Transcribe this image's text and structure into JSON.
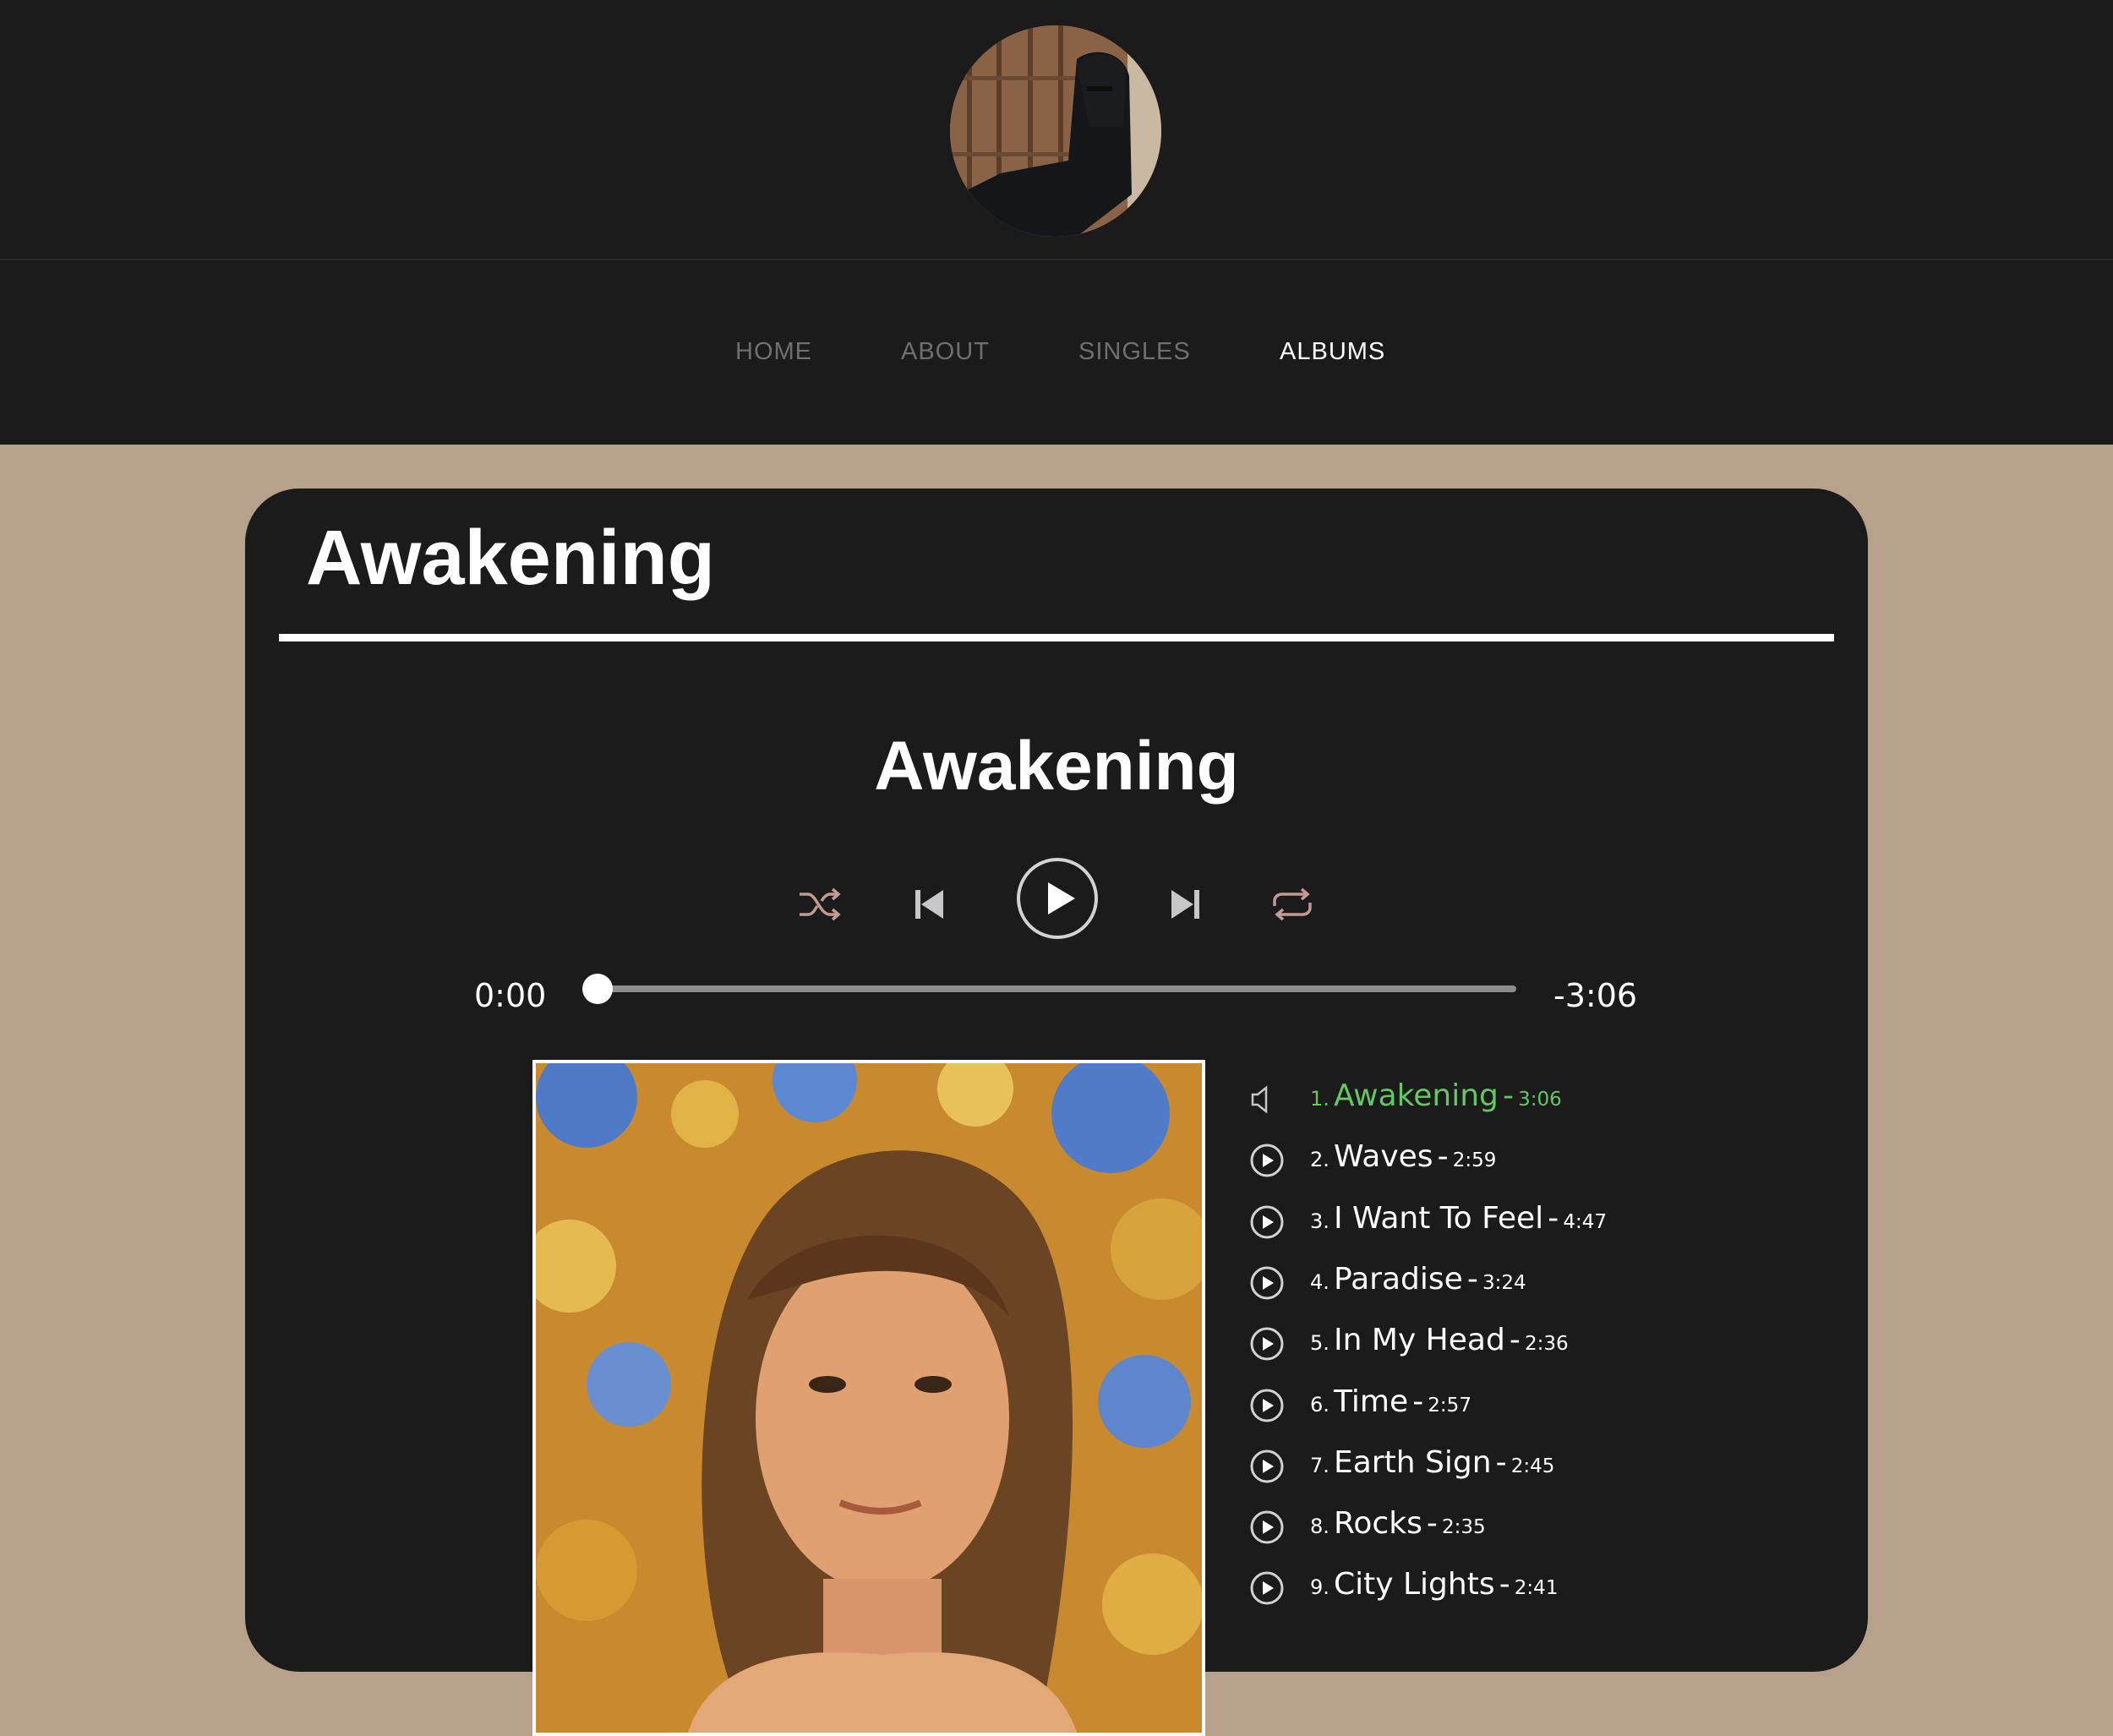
{
  "header": {
    "avatar_alt": "artist-avatar"
  },
  "nav": {
    "items": [
      {
        "label": "HOME",
        "active": false
      },
      {
        "label": "ABOUT",
        "active": false
      },
      {
        "label": "SINGLES",
        "active": false
      },
      {
        "label": "ALBUMS",
        "active": true
      }
    ]
  },
  "album": {
    "heading": "Awakening",
    "player_title": "Awakening",
    "elapsed": "0:00",
    "remaining": "-3:06",
    "progress": 0,
    "controls": [
      "shuffle-icon",
      "previous-icon",
      "play-icon",
      "next-icon",
      "repeat-icon"
    ],
    "tracks": [
      {
        "num": "1.",
        "title": "Awakening",
        "sep": "-",
        "duration": "3:06",
        "current": true
      },
      {
        "num": "2.",
        "title": "Waves",
        "sep": "-",
        "duration": "2:59",
        "current": false
      },
      {
        "num": "3.",
        "title": "I Want To Feel",
        "sep": "-",
        "duration": "4:47",
        "current": false
      },
      {
        "num": "4.",
        "title": "Paradise",
        "sep": "-",
        "duration": "3:24",
        "current": false
      },
      {
        "num": "5.",
        "title": "In My Head",
        "sep": "-",
        "duration": "2:36",
        "current": false
      },
      {
        "num": "6.",
        "title": "Time",
        "sep": "-",
        "duration": "2:57",
        "current": false
      },
      {
        "num": "7.",
        "title": "Earth Sign",
        "sep": "-",
        "duration": "2:45",
        "current": false
      },
      {
        "num": "8.",
        "title": "Rocks",
        "sep": "-",
        "duration": "2:35",
        "current": false
      },
      {
        "num": "9.",
        "title": "City Lights",
        "sep": "-",
        "duration": "2:41",
        "current": false
      }
    ]
  },
  "colors": {
    "header_bg": "#1b1b1c",
    "page_bg": "#b8a18a",
    "current_track": "#63c864",
    "control_accent": "#c29a91"
  }
}
